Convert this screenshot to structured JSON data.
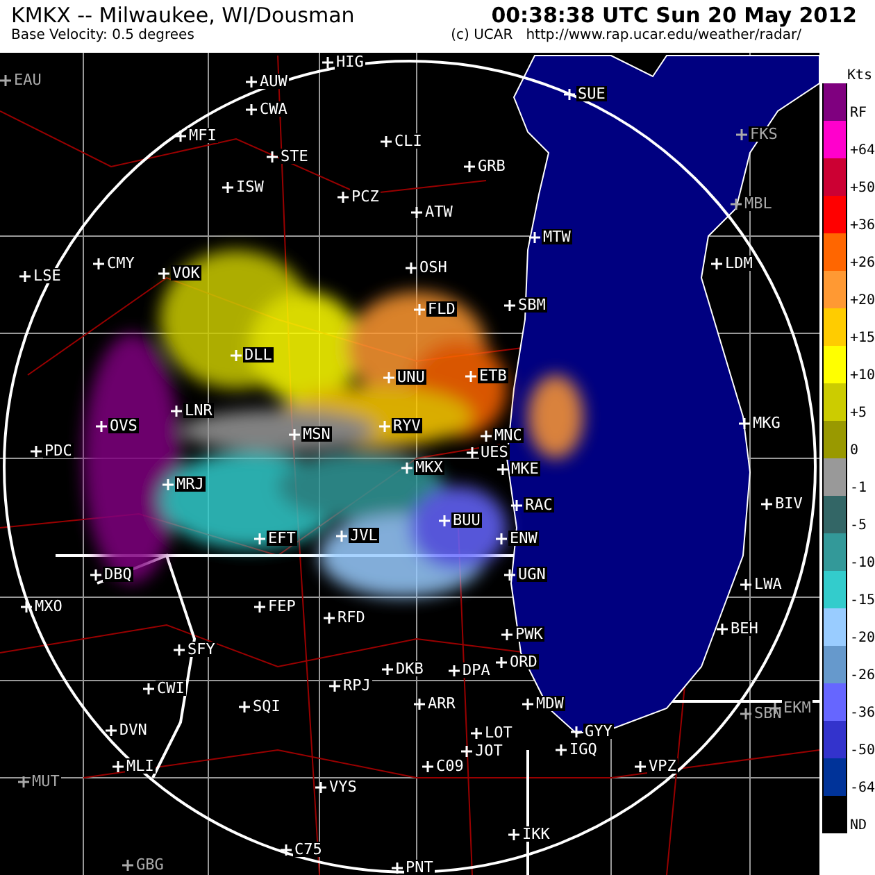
{
  "header": {
    "title": "KMKX -- Milwaukee, WI/Dousman",
    "timestamp": "00:38:38 UTC Sun 20 May 2012",
    "product": "Base Velocity: 0.5 degrees",
    "credit": "(c) UCAR   http://www.rap.ucar.edu/weather/radar/"
  },
  "map": {
    "stations": [
      {
        "label": "HIG",
        "dimmed": false
      },
      {
        "label": "EAU",
        "dimmed": true
      },
      {
        "label": "AUW",
        "dimmed": false
      },
      {
        "label": "SUE",
        "dimmed": false
      },
      {
        "label": "CWA",
        "dimmed": false
      },
      {
        "label": "MFI",
        "dimmed": false
      },
      {
        "label": "CLI",
        "dimmed": false
      },
      {
        "label": "FKS",
        "dimmed": true
      },
      {
        "label": "STE",
        "dimmed": false
      },
      {
        "label": "GRB",
        "dimmed": false
      },
      {
        "label": "ISW",
        "dimmed": false
      },
      {
        "label": "PCZ",
        "dimmed": false
      },
      {
        "label": "ATW",
        "dimmed": false
      },
      {
        "label": "MBL",
        "dimmed": true
      },
      {
        "label": "MTW",
        "dimmed": false
      },
      {
        "label": "LSE",
        "dimmed": false
      },
      {
        "label": "CMY",
        "dimmed": false
      },
      {
        "label": "VOK",
        "dimmed": false
      },
      {
        "label": "OSH",
        "dimmed": false
      },
      {
        "label": "LDM",
        "dimmed": false
      },
      {
        "label": "FLD",
        "dimmed": false
      },
      {
        "label": "SBM",
        "dimmed": false
      },
      {
        "label": "DLL",
        "dimmed": false
      },
      {
        "label": "UNU",
        "dimmed": false
      },
      {
        "label": "ETB",
        "dimmed": false
      },
      {
        "label": "LNR",
        "dimmed": false
      },
      {
        "label": "OVS",
        "dimmed": false
      },
      {
        "label": "MSN",
        "dimmed": false
      },
      {
        "label": "RYV",
        "dimmed": false
      },
      {
        "label": "MNC",
        "dimmed": false
      },
      {
        "label": "MKG",
        "dimmed": false
      },
      {
        "label": "PDC",
        "dimmed": false
      },
      {
        "label": "UES",
        "dimmed": false
      },
      {
        "label": "MKX",
        "dimmed": false
      },
      {
        "label": "MKE",
        "dimmed": false
      },
      {
        "label": "MRJ",
        "dimmed": false
      },
      {
        "label": "RAC",
        "dimmed": false
      },
      {
        "label": "BIV",
        "dimmed": false
      },
      {
        "label": "BUU",
        "dimmed": false
      },
      {
        "label": "EFT",
        "dimmed": false
      },
      {
        "label": "JVL",
        "dimmed": false
      },
      {
        "label": "ENW",
        "dimmed": false
      },
      {
        "label": "DBQ",
        "dimmed": false
      },
      {
        "label": "UGN",
        "dimmed": false
      },
      {
        "label": "LWA",
        "dimmed": false
      },
      {
        "label": "MXO",
        "dimmed": false
      },
      {
        "label": "FEP",
        "dimmed": false
      },
      {
        "label": "RFD",
        "dimmed": false
      },
      {
        "label": "PWK",
        "dimmed": false
      },
      {
        "label": "BEH",
        "dimmed": false
      },
      {
        "label": "SFY",
        "dimmed": false
      },
      {
        "label": "DKB",
        "dimmed": false
      },
      {
        "label": "DPA",
        "dimmed": false
      },
      {
        "label": "ORD",
        "dimmed": false
      },
      {
        "label": "CWI",
        "dimmed": false
      },
      {
        "label": "RPJ",
        "dimmed": false
      },
      {
        "label": "SQI",
        "dimmed": false
      },
      {
        "label": "ARR",
        "dimmed": false
      },
      {
        "label": "MDW",
        "dimmed": false
      },
      {
        "label": "SBN",
        "dimmed": true
      },
      {
        "label": "EKM",
        "dimmed": true
      },
      {
        "label": "DVN",
        "dimmed": false
      },
      {
        "label": "LOT",
        "dimmed": false
      },
      {
        "label": "GYY",
        "dimmed": false
      },
      {
        "label": "JOT",
        "dimmed": false
      },
      {
        "label": "IGQ",
        "dimmed": false
      },
      {
        "label": "MLI",
        "dimmed": false
      },
      {
        "label": "C09",
        "dimmed": false
      },
      {
        "label": "VPZ",
        "dimmed": false
      },
      {
        "label": "MUT",
        "dimmed": true
      },
      {
        "label": "VYS",
        "dimmed": false
      },
      {
        "label": "IKK",
        "dimmed": false
      },
      {
        "label": "C75",
        "dimmed": false
      },
      {
        "label": "GBG",
        "dimmed": true
      },
      {
        "label": "PNT",
        "dimmed": false
      }
    ]
  },
  "legend": {
    "unit": "Kts",
    "entries": [
      {
        "label": "RF",
        "color": "#7f007f"
      },
      {
        "label": "+64",
        "color": "#ff00cc"
      },
      {
        "label": "+50",
        "color": "#cc0033"
      },
      {
        "label": "+36",
        "color": "#ff0000"
      },
      {
        "label": "+26",
        "color": "#ff6600"
      },
      {
        "label": "+20",
        "color": "#ff9933"
      },
      {
        "label": "+15",
        "color": "#ffcc00"
      },
      {
        "label": "+10",
        "color": "#ffff00"
      },
      {
        "label": "+5",
        "color": "#cccc00"
      },
      {
        "label": "0",
        "color": "#999900"
      },
      {
        "label": "-1",
        "color": "#999999"
      },
      {
        "label": "-5",
        "color": "#336666"
      },
      {
        "label": "-10",
        "color": "#339999"
      },
      {
        "label": "-15",
        "color": "#33cccc"
      },
      {
        "label": "-20",
        "color": "#99ccff"
      },
      {
        "label": "-26",
        "color": "#6699cc"
      },
      {
        "label": "-36",
        "color": "#6666ff"
      },
      {
        "label": "-50",
        "color": "#3333cc"
      },
      {
        "label": "-64",
        "color": "#003399"
      },
      {
        "label": "ND",
        "color": "#000000"
      }
    ]
  }
}
